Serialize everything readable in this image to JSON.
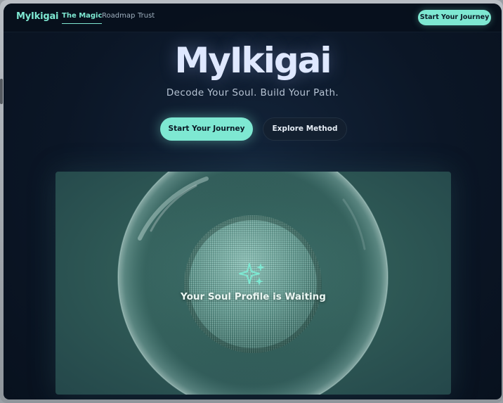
{
  "brand": {
    "name": "MyIkigai"
  },
  "nav": {
    "links": [
      {
        "label": "The Magic",
        "active": true
      },
      {
        "label": "Roadmap",
        "active": false
      },
      {
        "label": "Trust",
        "active": false
      }
    ],
    "cta_label": "Start Your Journey"
  },
  "hero": {
    "title": "MyIkigai",
    "subtitle": "Decode Your Soul. Build Your Path.",
    "primary_button": "Start Your Journey",
    "secondary_button": "Explore Method"
  },
  "orb": {
    "label": "Your Soul Profile is Waiting",
    "icon": "sparkles-icon"
  },
  "colors": {
    "accent": "#7ee8d2",
    "background": "#0b1626",
    "card": "#2f5a56"
  }
}
